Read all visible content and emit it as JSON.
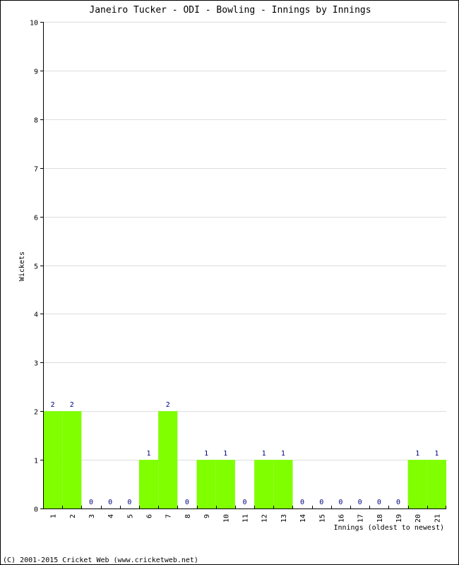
{
  "chart_data": {
    "type": "bar",
    "title": "Janeiro Tucker - ODI - Bowling - Innings by Innings",
    "xlabel": "Innings (oldest to newest)",
    "ylabel": "Wickets",
    "ylim": [
      0,
      10
    ],
    "yticks": [
      "0",
      "1",
      "2",
      "3",
      "4",
      "5",
      "6",
      "7",
      "8",
      "9",
      "10"
    ],
    "grid": true,
    "categories": [
      "1",
      "2",
      "3",
      "4",
      "5",
      "6",
      "7",
      "8",
      "9",
      "10",
      "11",
      "12",
      "13",
      "14",
      "15",
      "16",
      "17",
      "18",
      "19",
      "20",
      "21"
    ],
    "values": [
      2,
      2,
      0,
      0,
      0,
      1,
      2,
      0,
      1,
      1,
      0,
      1,
      1,
      0,
      0,
      0,
      0,
      0,
      0,
      1,
      1
    ],
    "bar_color": "#80ff00",
    "label_color": "#000080",
    "grid_color": "#dddddd"
  },
  "footer": "(C) 2001-2015 Cricket Web (www.cricketweb.net)"
}
